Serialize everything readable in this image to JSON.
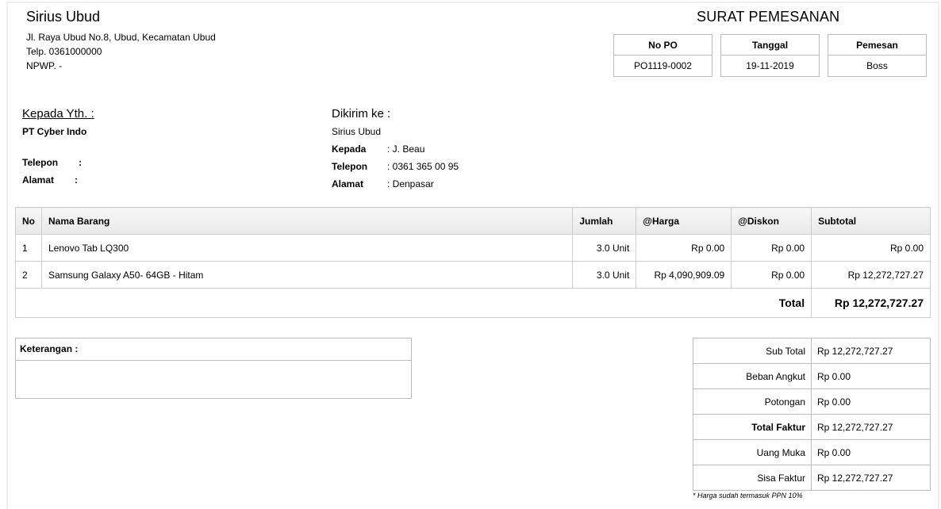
{
  "company": {
    "name": "Sirius Ubud",
    "address": "Jl. Raya Ubud No.8, Ubud, Kecamatan Ubud",
    "phone": "Telp. 0361000000",
    "npwp": "NPWP. -"
  },
  "document": {
    "title": "SURAT PEMESANAN",
    "po_label": "No PO",
    "po_value": "PO1119-0002",
    "date_label": "Tanggal",
    "date_value": "19-11-2019",
    "orderer_label": "Pemesan",
    "orderer_value": "Boss"
  },
  "recipient": {
    "heading": "Kepada Yth. :",
    "name": "PT Cyber Indo",
    "phone_label": "Telepon",
    "phone_colon": ":",
    "address_label": "Alamat",
    "address_colon": ":"
  },
  "shipping": {
    "heading": "Dikirim ke :",
    "name": "Sirius Ubud",
    "contact_label": "Kepada",
    "contact_value": ": J. Beau",
    "phone_label": "Telepon",
    "phone_value": ": 0361 365 00 95",
    "address_label": "Alamat",
    "address_value": ": Denpasar"
  },
  "items_table": {
    "headers": [
      "No",
      "Nama Barang",
      "Jumlah",
      "@Harga",
      "@Diskon",
      "Subtotal"
    ],
    "rows": [
      [
        "1",
        "Lenovo Tab LQ300",
        "3.0 Unit",
        "Rp 0.00",
        "Rp 0.00",
        "Rp 0.00"
      ],
      [
        "2",
        "Samsung Galaxy A50- 64GB - Hitam",
        "3.0 Unit",
        "Rp 4,090,909.09",
        "Rp 0.00",
        "Rp 12,272,727.27"
      ]
    ],
    "total_label": "Total",
    "total_value": "Rp 12,272,727.27"
  },
  "notes": {
    "label": "Keterangan :"
  },
  "summary": {
    "rows": [
      {
        "label": "Sub Total",
        "value": "Rp 12,272,727.27"
      },
      {
        "label": "Beban Angkut",
        "value": "Rp 0.00"
      },
      {
        "label": "Potongan",
        "value": "Rp 0.00"
      },
      {
        "label": "Total Faktur",
        "value": "Rp 12,272,727.27"
      },
      {
        "label": "Uang Muka",
        "value": "Rp 0.00"
      },
      {
        "label": "Sisa Faktur",
        "value": "Rp 12,272,727.27"
      }
    ],
    "footnote": "* Harga sudah termasuk PPN 10%"
  }
}
